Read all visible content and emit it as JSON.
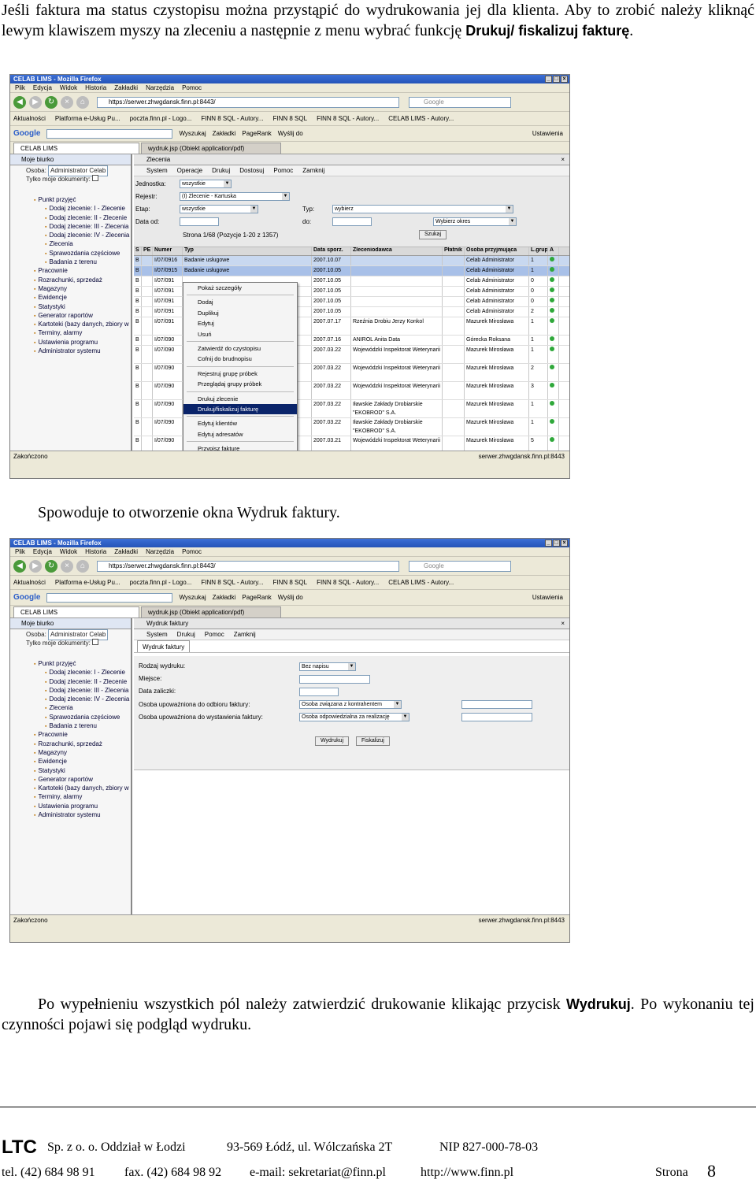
{
  "paragraph1": {
    "text": "Jeśli faktura ma status czystopisu można przystąpić do wydrukowania jej dla klienta. Aby to zrobić należy kliknąć lewym klawiszem myszy na zleceniu a następnie z menu wybrać funkcję ",
    "bold": "Drukuj/ fiskalizuj fakturę",
    "tail": "."
  },
  "paragraph2": "Spowoduje to otworzenie okna Wydruk faktury.",
  "paragraph3": {
    "text": "Po wypełnieniu wszystkich pól należy zatwierdzić drukowanie klikając przycisk ",
    "bold": "Wydrukuj",
    "tail": ". Po wykonaniu tej czynności pojawi się podgląd wydruku."
  },
  "browser": {
    "title": "CELAB LIMS - Mozilla Firefox",
    "menu": [
      "Plik",
      "Edycja",
      "Widok",
      "Historia",
      "Zakładki",
      "Narzędzia",
      "Pomoc"
    ],
    "url": "https://serwer.zhwgdansk.finn.pl:8443/",
    "search_placeholder": "Google",
    "bookmarks": [
      "Aktualności",
      "Platforma e-Usług Pu...",
      "poczta.finn.pl - Logo...",
      "FINN 8 SQL - Autory...",
      "FINN 8 SQL",
      "FINN 8 SQL - Autory...",
      "CELAB LIMS - Autory..."
    ],
    "google_toolbar": [
      "Wyszukaj",
      "Zakładki",
      "PageRank",
      "Wyślij do",
      "Ustawienia"
    ],
    "tab1": "CELAB LIMS",
    "tab2": "wydruk.jsp (Obiekt application/pdf)",
    "status_left": "Zakończono",
    "status_right": "serwer.zhwgdansk.finn.pl:8443"
  },
  "sidebar": {
    "header": "Moje biurko",
    "osoba_label": "Osoba:",
    "osoba_value": "Administrator Celab",
    "only_mine": "Tylko moje dokumenty:",
    "tree": [
      {
        "label": "Punkt przyjęć",
        "sub": false
      },
      {
        "label": "Dodaj zlecenie: I - Zlecenie",
        "sub": true
      },
      {
        "label": "Dodaj zlecenie: II - Zlecenie",
        "sub": true
      },
      {
        "label": "Dodaj zlecenie: III - Zlecenia",
        "sub": true
      },
      {
        "label": "Dodaj zlecenie: IV - Zlecenia",
        "sub": true
      },
      {
        "label": "Zlecenia",
        "sub": true
      },
      {
        "label": "Sprawozdania częściowe",
        "sub": true
      },
      {
        "label": "Badania z terenu",
        "sub": true
      },
      {
        "label": "Pracownie",
        "sub": false
      },
      {
        "label": "Rozrachunki, sprzedaż",
        "sub": false
      },
      {
        "label": "Magazyny",
        "sub": false
      },
      {
        "label": "Ewidencje",
        "sub": false
      },
      {
        "label": "Statystyki",
        "sub": false
      },
      {
        "label": "Generator raportów",
        "sub": false
      },
      {
        "label": "Kartoteki (bazy danych, zbiory w",
        "sub": false
      },
      {
        "label": "Terminy, alarmy",
        "sub": false
      },
      {
        "label": "Ustawienia programu",
        "sub": false
      },
      {
        "label": "Administrator systemu",
        "sub": false
      }
    ]
  },
  "shot1": {
    "panel_title": "Zlecenia",
    "menu": [
      "System",
      "Operacje",
      "Drukuj",
      "Dostosuj",
      "Pomoc",
      "Zamknij"
    ],
    "filters": {
      "jednostka_label": "Jednostka:",
      "jednostka_value": "wszystkie",
      "rejestr_label": "Rejestr:",
      "rejestr_value": "(I) Zlecenie - Kartuska",
      "etap_label": "Etap:",
      "etap_value": "wszystkie",
      "typ_label": "Typ:",
      "typ_value": "wybierz",
      "data_od_label": "Data od:",
      "do_label": "do:",
      "okres_value": "Wybierz okres",
      "pagination": "Strona 1/68 (Pozycje 1-20 z 1357)",
      "szukaj": "Szukaj"
    },
    "columns": [
      "S",
      "PE",
      "Numer",
      "Typ",
      "Data sporz.",
      "Zleceniodawca",
      "Płatnik",
      "Osoba przyjmująca",
      "L.grup",
      "A"
    ],
    "rows": [
      {
        "numer": "I/07/0916",
        "typ": "Badanie usługowe",
        "data": "2007.10.07",
        "zlec": "",
        "osoba": "Celab Administrator",
        "l": "1"
      },
      {
        "numer": "I/07/0915",
        "typ": "Badanie usługowe",
        "data": "2007.10.05",
        "zlec": "",
        "osoba": "Celab Administrator",
        "l": "1"
      },
      {
        "numer": "I/07/091",
        "typ": "",
        "data": "2007.10.05",
        "zlec": "",
        "osoba": "Celab Administrator",
        "l": "0"
      },
      {
        "numer": "I/07/091",
        "typ": "",
        "data": "2007.10.05",
        "zlec": "",
        "osoba": "Celab Administrator",
        "l": "0"
      },
      {
        "numer": "I/07/091",
        "typ": "",
        "data": "2007.10.05",
        "zlec": "",
        "osoba": "Celab Administrator",
        "l": "0"
      },
      {
        "numer": "I/07/091",
        "typ": "",
        "data": "2007.10.05",
        "zlec": "",
        "osoba": "Celab Administrator",
        "l": "2"
      },
      {
        "numer": "I/07/091",
        "typ": "",
        "data": "2007.07.17",
        "zlec": "Rzeźnia Drobiu Jerzy Konkol",
        "osoba": "Mazurek Mirosława",
        "l": "1"
      },
      {
        "numer": "I/07/090",
        "typ": "",
        "data": "2007.07.16",
        "zlec": "ANIROL Anita Data",
        "osoba": "Górecka Roksana",
        "l": "1"
      },
      {
        "numer": "I/07/090",
        "typ": "",
        "data": "2007.03.22",
        "zlec": "Wojewódzki Inspektorat Weterynarii",
        "osoba": "Mazurek Mirosława",
        "l": "1"
      },
      {
        "numer": "I/07/090",
        "typ": "",
        "data": "2007.03.22",
        "zlec": "Wojewódzki Inspektorat Weterynarii",
        "osoba": "Mazurek Mirosława",
        "l": "2"
      },
      {
        "numer": "I/07/090",
        "typ": "",
        "data": "2007.03.22",
        "zlec": "Wojewódzki Inspektorat Weterynarii",
        "osoba": "Mazurek Mirosława",
        "l": "3"
      },
      {
        "numer": "I/07/090",
        "typ": "",
        "data": "2007.03.22",
        "zlec": "Iławskie Zakłady Drobiarskie \"EKOBROD\" S.A.",
        "osoba": "Mazurek Mirosława",
        "l": "1"
      },
      {
        "numer": "I/07/090",
        "typ": "",
        "data": "2007.03.22",
        "zlec": "Iławskie Zakłady Drobiarskie \"EKOBROD\" S.A.",
        "osoba": "Mazurek Mirosława",
        "l": "1"
      },
      {
        "numer": "I/07/090",
        "typ": "",
        "data": "2007.03.21",
        "zlec": "Wojewódzki Inspektorat Weterynarii",
        "osoba": "Mazurek Mirosława",
        "l": "5"
      }
    ],
    "context_menu": [
      {
        "label": "Pokaż szczegóły",
        "sep": true
      },
      {
        "label": "Dodaj",
        "sep": false
      },
      {
        "label": "Duplikuj",
        "sep": false
      },
      {
        "label": "Edytuj",
        "sep": false
      },
      {
        "label": "Usuń",
        "sep": true
      },
      {
        "label": "Zatwierdź do czystopisu",
        "sep": false
      },
      {
        "label": "Cofnij do brudnopisu",
        "sep": true
      },
      {
        "label": "Rejestruj grupę próbek",
        "sep": false
      },
      {
        "label": "Przeglądaj grupy próbek",
        "sep": true
      },
      {
        "label": "Drukuj zlecenie",
        "sep": false
      },
      {
        "label": "Drukuj/fiskalizuj fakturę",
        "sep": true,
        "highlight": true
      },
      {
        "label": "Edytuj klientów",
        "sep": false
      },
      {
        "label": "Edytuj adresatów",
        "sep": true
      },
      {
        "label": "Przypisz fakturę",
        "sep": false
      }
    ]
  },
  "shot2": {
    "panel_title": "Wydruk faktury",
    "menu": [
      "System",
      "Drukuj",
      "Pomoc",
      "Zamknij"
    ],
    "subtab": "Wydruk faktury",
    "rodzaj_label": "Rodzaj wydruku:",
    "rodzaj_value": "Bez napisu",
    "miejsce_label": "Miejsce:",
    "data_zaliczki_label": "Data zaliczki:",
    "odbior_label": "Osoba upoważniona do odbioru faktury:",
    "odbior_value": "Osoba związana z kontrahentem",
    "wystawienie_label": "Osoba upoważniona do wystawienia faktury:",
    "wystawienie_value": "Osoba odpowiedzialna za realizację",
    "wydrukuj": "Wydrukuj",
    "fiskalizuj": "Fiskalizuj"
  },
  "footer": {
    "company": "LTC",
    "company_rest": "Sp. z o. o. Oddział w Łodzi",
    "address": "93-569 Łódź, ul. Wólczańska 2T",
    "nip": "NIP 827-000-78-03",
    "tel": "tel. (42) 684 98 91",
    "fax": "fax. (42) 684 98 92",
    "email": "e-mail:  sekretariat@finn.pl",
    "www": "http://www.finn.pl",
    "strona_label": "Strona",
    "page_number": "8"
  }
}
